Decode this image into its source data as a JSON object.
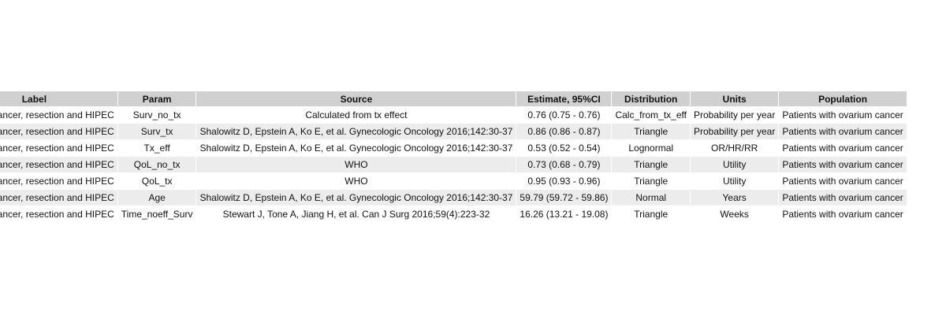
{
  "table": {
    "headers": [
      "Label",
      "Param",
      "Source",
      "Estimate, 95%CI",
      "Distribution",
      "Units",
      "Population"
    ],
    "rows": [
      [
        "Ovarium cancer, resection and HIPEC",
        "Surv_no_tx",
        "Calculated from tx effect",
        "0.76 (0.75 - 0.76)",
        "Calc_from_tx_eff",
        "Probability per year",
        "Patients with ovarium cancer"
      ],
      [
        "Ovarium cancer, resection and HIPEC",
        "Surv_tx",
        "Shalowitz D, Epstein A, Ko E, et al. Gynecologic Oncology 2016;142:30-37",
        "0.86 (0.86 - 0.87)",
        "Triangle",
        "Probability per year",
        "Patients with ovarium cancer"
      ],
      [
        "Ovarium cancer, resection and HIPEC",
        "Tx_eff",
        "Shalowitz D, Epstein A, Ko E, et al. Gynecologic Oncology 2016;142:30-37",
        "0.53 (0.52 - 0.54)",
        "Lognormal",
        "OR/HR/RR",
        "Patients with ovarium cancer"
      ],
      [
        "Ovarium cancer, resection and HIPEC",
        "QoL_no_tx",
        "WHO",
        "0.73 (0.68 - 0.79)",
        "Triangle",
        "Utility",
        "Patients with ovarium cancer"
      ],
      [
        "Ovarium cancer, resection and HIPEC",
        "QoL_tx",
        "WHO",
        "0.95 (0.93 - 0.96)",
        "Triangle",
        "Utility",
        "Patients with ovarium cancer"
      ],
      [
        "Ovarium cancer, resection and HIPEC",
        "Age",
        "Shalowitz D, Epstein A, Ko E, et al. Gynecologic Oncology 2016;142:30-37",
        "59.79 (59.72 - 59.86)",
        "Normal",
        "Years",
        "Patients with ovarium cancer"
      ],
      [
        "Ovarium cancer, resection and HIPEC",
        "Time_noeff_Surv",
        "Stewart J, Tone A, Jiang H, et al. Can J Surg 2016;59(4):223-32",
        "16.26 (13.21 - 19.08)",
        "Triangle",
        "Weeks",
        "Patients with ovarium cancer"
      ]
    ]
  }
}
